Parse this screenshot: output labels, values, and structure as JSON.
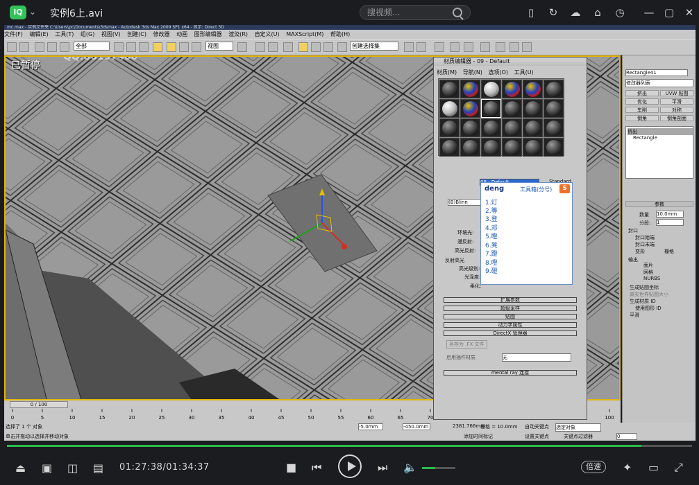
{
  "player": {
    "logo": "iQ",
    "title": "实例6上.avi",
    "search_placeholder": "搜视频...",
    "current_time": "01:27:38",
    "total_time": "01:34:37",
    "time_sep": "/",
    "speed_label": "倍速",
    "progress": 0.926,
    "volume": 0.4
  },
  "max": {
    "titlebar": "mc.max - 实例文件夹 C:\\Users\\pc\\Documents\\3dsmax - Autodesk 3ds Max 2009 SP1 x64 - 显示: Direct 3D",
    "menu": [
      "文件(F)",
      "编辑(E)",
      "工具(T)",
      "组(G)",
      "视图(V)",
      "创建(C)",
      "修改器",
      "动画",
      "图形编辑器",
      "渲染(R)",
      "自定义(U)",
      "MAXScript(M)",
      "帮助(H)"
    ],
    "toolbar_combo_all": "全部",
    "toolbar_combo_view": "视图",
    "toolbar_combo_sel": "创建选择集",
    "viewport_paused": "已暂停",
    "watermark": "QQ:86197400",
    "frame_counter": "0 / 100",
    "ticks": [
      "0",
      "5",
      "10",
      "15",
      "20",
      "25",
      "30",
      "35",
      "40",
      "45",
      "50",
      "55",
      "60",
      "65",
      "70",
      "75",
      "80",
      "85",
      "90",
      "95",
      "100"
    ],
    "status_selected": "选择了 1 个 对象",
    "status_hint": "单击并拖动以选择并移动对象",
    "coord_x": "-5.0mm",
    "coord_y": "-450.0mm",
    "coord_z": "2381.766mm",
    "grid_label": "栅格 = 10.0mm",
    "autokey": "自动关键点",
    "setkey": "设置关键点",
    "sel_obj": "选定对象",
    "key_filter": "关键点过滤器",
    "add_time_tag": "添加时间标记",
    "frame_input": "0"
  },
  "right_panel": {
    "object_name": "Rectangle41",
    "modifier_list": "修改器列表",
    "buttons": [
      "挤出",
      "UVW 贴图",
      "优化",
      "平滑",
      "车削",
      "对称",
      "倒角",
      "倒角剖面"
    ],
    "stack_items": [
      "挤出",
      "Rectangle"
    ],
    "params_title": "参数",
    "amount_label": "数量",
    "amount_value": "10.0mm",
    "segments_label": "分段:",
    "segments_value": "1",
    "capping_title": "封口",
    "cap_start": "封口始端",
    "cap_end": "封口末端",
    "morph": "变形",
    "grid": "栅格",
    "output_title": "输出",
    "patch": "面片",
    "mesh": "网格",
    "nurbs": "NURBS",
    "gen_map": "生成贴图坐标",
    "real_world": "真实世界贴图大小",
    "gen_mat": "生成材质 ID",
    "use_shape": "使用图形 ID",
    "smooth": "平滑"
  },
  "material_editor": {
    "title": "材质编辑器 - 09 - Default",
    "menu": [
      "材质(M)",
      "导航(N)",
      "选项(O)",
      "工具(U)"
    ],
    "material_name": "09 - Default",
    "material_type": "Standard",
    "shader": "(B)Blinn",
    "labels": [
      "环境光:",
      "漫反射:",
      "高光反射:",
      "反射高光",
      "高光级别:",
      "光泽度:",
      "柔化:"
    ],
    "rollouts": [
      "扩展参数",
      "超级采样",
      "贴图",
      "动力学属性",
      "DirectX 管理器"
    ],
    "save_fx": "另存为 .FX 文件",
    "enable_plugin": "启用插件材质",
    "plugin_value": "无",
    "mental_ray": "mental ray 连接"
  },
  "ime": {
    "input": "deng",
    "label": "工具箱(分号)",
    "candidates": [
      "1.灯",
      "2.等",
      "3.登",
      "4.邓",
      "5.瞪",
      "6.凳",
      "7.蹬",
      "8.噔",
      "9.磴"
    ],
    "brand": "S"
  }
}
